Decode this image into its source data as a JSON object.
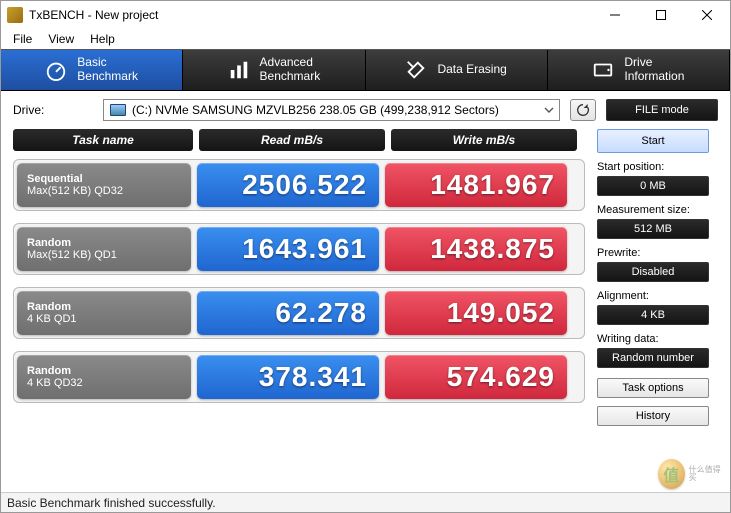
{
  "window": {
    "title": "TxBENCH - New project"
  },
  "menu": {
    "file": "File",
    "view": "View",
    "help": "Help"
  },
  "tabs": {
    "basic": "Basic\nBenchmark",
    "advanced": "Advanced\nBenchmark",
    "erasing": "Data Erasing",
    "driveinfo": "Drive\nInformation"
  },
  "drive": {
    "label": "Drive:",
    "selected": "(C:) NVMe SAMSUNG MZVLB256  238.05 GB (499,238,912 Sectors)"
  },
  "mode_button": "FILE mode",
  "headers": {
    "task": "Task name",
    "read": "Read mB/s",
    "write": "Write mB/s"
  },
  "rows": [
    {
      "name": "Sequential",
      "sub": "Max(512 KB) QD32",
      "read": "2506.522",
      "write": "1481.967"
    },
    {
      "name": "Random",
      "sub": "Max(512 KB) QD1",
      "read": "1643.961",
      "write": "1438.875"
    },
    {
      "name": "Random",
      "sub": "4 KB QD1",
      "read": "62.278",
      "write": "149.052"
    },
    {
      "name": "Random",
      "sub": "4 KB QD32",
      "read": "378.341",
      "write": "574.629"
    }
  ],
  "side": {
    "start": "Start",
    "start_pos_label": "Start position:",
    "start_pos_value": "0 MB",
    "meas_label": "Measurement size:",
    "meas_value": "512 MB",
    "prewrite_label": "Prewrite:",
    "prewrite_value": "Disabled",
    "align_label": "Alignment:",
    "align_value": "4 KB",
    "writing_label": "Writing data:",
    "writing_value": "Random number",
    "task_options": "Task options",
    "history": "History"
  },
  "status": "Basic Benchmark finished successfully.",
  "watermark": "什么值得买"
}
